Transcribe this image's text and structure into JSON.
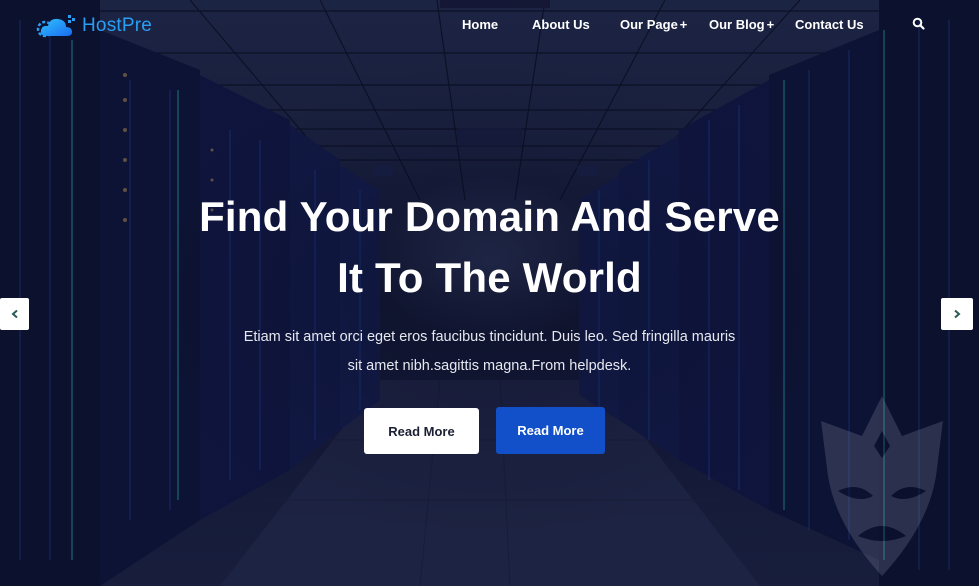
{
  "header": {
    "logo_text": "HostPre",
    "logo_icon": "cloud-gear-icon",
    "nav": [
      {
        "label": "Home",
        "has_submenu": false
      },
      {
        "label": "About Us",
        "has_submenu": false
      },
      {
        "label": "Our Page",
        "has_submenu": true
      },
      {
        "label": "Our Blog",
        "has_submenu": true
      },
      {
        "label": "Contact Us",
        "has_submenu": false
      }
    ],
    "submenu_marker": "+",
    "search_icon": "search-icon"
  },
  "hero": {
    "title_line1": "Find Your Domain And Serve",
    "title_line2": "It To The World",
    "subtitle_line1": "Etiam sit amet orci eget eros faucibus tincidunt. Duis leo. Sed fringilla mauris",
    "subtitle_line2": "sit amet nibh.sagittis magna.From helpdesk.",
    "buttons": [
      {
        "label": "Read More",
        "style": "white"
      },
      {
        "label": "Read More",
        "style": "blue"
      }
    ],
    "prev_icon": "chevron-left-icon",
    "next_icon": "chevron-right-icon"
  },
  "colors": {
    "brand": "#2a9df4",
    "primary_button": "#1150c8",
    "secondary_button": "#ffffff",
    "text": "#ffffff"
  }
}
